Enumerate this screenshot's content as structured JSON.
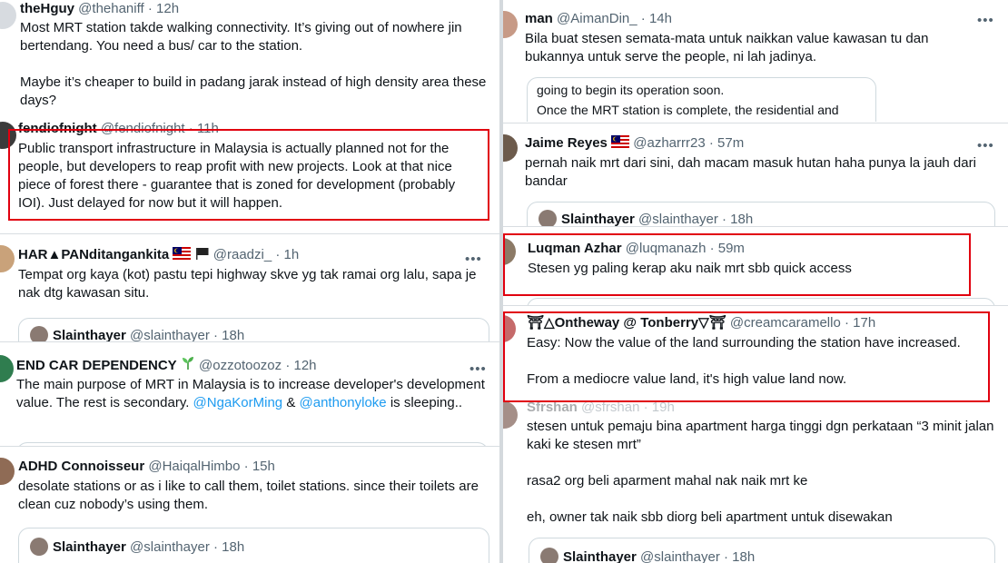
{
  "left": {
    "t1": {
      "name": "theHguy",
      "handle": "@thehaniff",
      "time": "12h",
      "body": "Most MRT station takde walking connectivity. It’s giving out of nowhere jin bertendang. You need a bus/ car to the station.\n\nMaybe it’s cheaper to build in padang jarak instead of high density area these days?"
    },
    "t2": {
      "name": "fendiofnight",
      "handle": "@fendiofnight",
      "time": "11h",
      "body": "Public transport infrastructure in Malaysia is actually planned not for the people, but  developers to reap profit with new projects. Look at that nice piece of forest there - guarantee that is zoned for development (probably IOI). Just delayed for now but it will happen."
    },
    "t3": {
      "name": "HAR▲PANditangankita",
      "handle": "@raadzi_",
      "time": "1h",
      "body": "Tempat org kaya (kot) pastu tepi highway skve yg tak ramai org lalu, sapa je nak dtg kawasan situ.",
      "quote_name": "Slainthayer",
      "quote_handle": "@slainthayer",
      "quote_time": "18h"
    },
    "t4": {
      "name": "END CAR DEPENDENCY",
      "handle": "@ozzotoozoz",
      "time": "12h",
      "body_a": "The main purpose of MRT in Malaysia is to increase developer's development value. The rest is secondary.",
      "mention1": "@NgaKorMing",
      "amp": "&",
      "mention2": "@anthonyloke",
      "body_b": "is sleeping.."
    },
    "t5": {
      "name": "ADHD Connoisseur",
      "handle": "@HaiqalHimbo",
      "time": "15h",
      "body": "desolate stations or as i like to call them, toilet stations. since their toilets are clean cuz nobody’s using them.",
      "quote_name": "Slainthayer",
      "quote_handle": "@slainthayer",
      "quote_time": "18h"
    }
  },
  "right": {
    "t1": {
      "name": "man",
      "handle": "@AimanDin_",
      "time": "14h",
      "body": "Bila buat stesen semata-mata untuk naikkan value kawasan tu dan bukannya untuk serve the people, ni lah jadinya.",
      "quote_line1": "going to begin its operation soon.",
      "quote_line2": "Once the MRT station is complete, the residential and"
    },
    "t2": {
      "name": "Jaime Reyes",
      "handle": "@azharrr23",
      "time": "57m",
      "body": "pernah naik mrt dari sini, dah macam masuk hutan haha punya la jauh dari bandar",
      "quote_name": "Slainthayer",
      "quote_handle": "@slainthayer",
      "quote_time": "18h"
    },
    "t3": {
      "name": "Luqman Azhar",
      "handle": "@luqmanazh",
      "time": "59m",
      "body": "Stesen yg paling kerap aku naik mrt sbb quick access"
    },
    "t4": {
      "name": "⛩△Ontheway @ Tonberry▽⛩",
      "handle": "@creamcaramello",
      "time": "17h",
      "body": "Easy: Now the value of the land surrounding the station have increased.\n\nFrom a mediocre value land, it's high value land now."
    },
    "t5": {
      "name": "Sfrshan",
      "handle": "@sfrshan",
      "time": "19h",
      "body": "stesen untuk pemaju bina apartment harga tinggi dgn perkataan “3 minit jalan kaki ke stesen mrt”\n\nrasa2 org beli aparment mahal nak naik mrt ke\n\neh, owner tak naik sbb diorg beli apartment untuk disewakan",
      "quote_name": "Slainthayer",
      "quote_handle": "@slainthayer",
      "quote_time": "18h"
    }
  },
  "ui": {
    "sep": "·",
    "more": "•••"
  },
  "colors": {
    "highlight_box": "#e1000f",
    "link": "#1d9bf0",
    "muted_text": "#536471"
  }
}
